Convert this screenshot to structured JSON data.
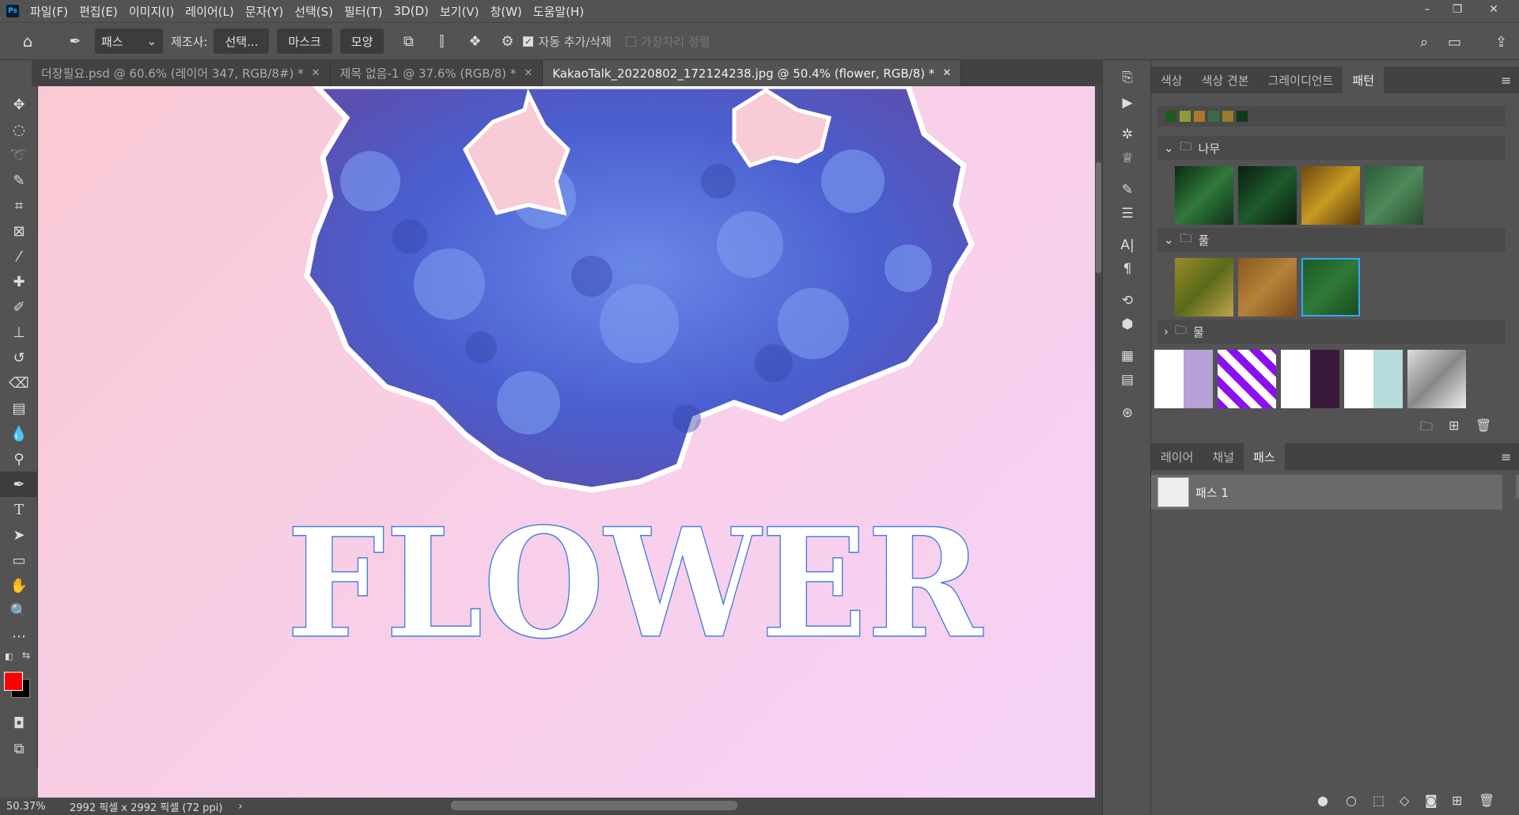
{
  "app": "Photoshop",
  "menu": [
    "파일(F)",
    "편집(E)",
    "이미지(I)",
    "레이어(L)",
    "문자(Y)",
    "선택(S)",
    "필터(T)",
    "3D(D)",
    "보기(V)",
    "창(W)",
    "도움말(H)"
  ],
  "options": {
    "mode": "패스",
    "make_label": "제조사:",
    "select_btn": "선택...",
    "mask_btn": "마스크",
    "shape_btn": "모양",
    "auto_add": "자동 추가/삭제",
    "align_edges": "가장자리 정렬"
  },
  "tabs": [
    {
      "label": "더장필요.psd @ 60.6% (레이어 347, RGB/8#) *",
      "active": false
    },
    {
      "label": "제목 없음-1 @ 37.6% (RGB/8) *",
      "active": false
    },
    {
      "label": "KakaoTalk_20220802_172124238.jpg @ 50.4% (flower, RGB/8) *",
      "active": true
    }
  ],
  "canvas": {
    "text": "FLOWER"
  },
  "status": {
    "zoom": "50.37%",
    "dims": "2992 픽셀 x 2992 픽셀 (72 ppi)"
  },
  "colors": {
    "foreground": "#ff0000",
    "background": "#000000",
    "accent": "#31a8ff"
  },
  "pattern_panel": {
    "tabs": [
      "색상",
      "색상 견본",
      "그레이디언트",
      "패턴"
    ],
    "active": "패턴",
    "groups": [
      "나무",
      "풀",
      "물"
    ]
  },
  "paths_panel": {
    "tabs": [
      "레이어",
      "채널",
      "패스"
    ],
    "active": "패스",
    "items": [
      "패스 1"
    ]
  }
}
